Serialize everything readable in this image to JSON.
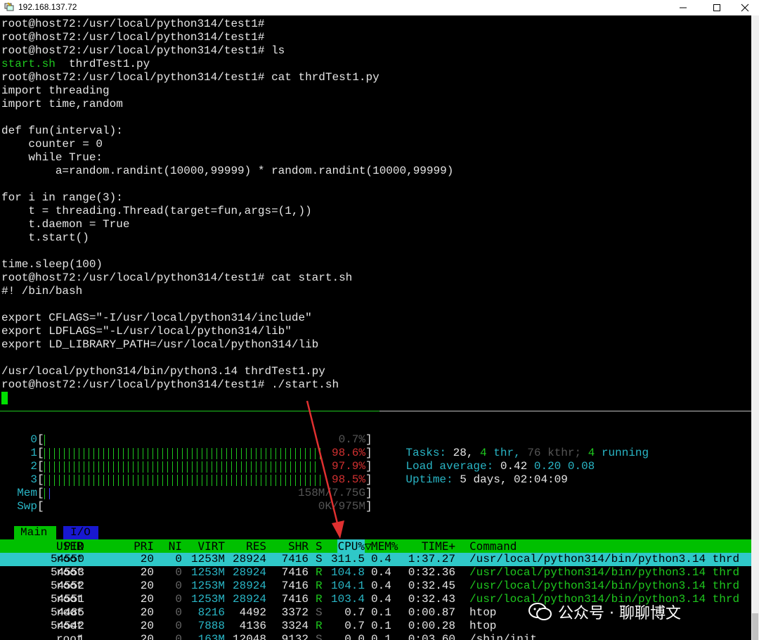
{
  "window": {
    "title": "192.168.137.72"
  },
  "terminal_lines": [
    {
      "segments": [
        {
          "t": "root@host72:/usr/local/python314/test1#",
          "c": "w"
        }
      ]
    },
    {
      "segments": [
        {
          "t": "root@host72:/usr/local/python314/test1#",
          "c": "w"
        }
      ]
    },
    {
      "segments": [
        {
          "t": "root@host72:/usr/local/python314/test1# ls",
          "c": "w"
        }
      ]
    },
    {
      "segments": [
        {
          "t": "start.sh",
          "c": "g"
        },
        {
          "t": "  thrdTest1.py",
          "c": "w"
        }
      ]
    },
    {
      "segments": [
        {
          "t": "root@host72:/usr/local/python314/test1# cat thrdTest1.py",
          "c": "w"
        }
      ]
    },
    {
      "segments": [
        {
          "t": "import threading",
          "c": "w"
        }
      ]
    },
    {
      "segments": [
        {
          "t": "import time,random",
          "c": "w"
        }
      ]
    },
    {
      "segments": [
        {
          "t": "",
          "c": "w"
        }
      ]
    },
    {
      "segments": [
        {
          "t": "def fun(interval):",
          "c": "w"
        }
      ]
    },
    {
      "segments": [
        {
          "t": "    counter = 0",
          "c": "w"
        }
      ]
    },
    {
      "segments": [
        {
          "t": "    while True:",
          "c": "w"
        }
      ]
    },
    {
      "segments": [
        {
          "t": "        a=random.randint(10000,99999) * random.randint(10000,99999)",
          "c": "w"
        }
      ]
    },
    {
      "segments": [
        {
          "t": "",
          "c": "w"
        }
      ]
    },
    {
      "segments": [
        {
          "t": "for i in range(3):",
          "c": "w"
        }
      ]
    },
    {
      "segments": [
        {
          "t": "    t = threading.Thread(target=fun,args=(1,))",
          "c": "w"
        }
      ]
    },
    {
      "segments": [
        {
          "t": "    t.daemon = True",
          "c": "w"
        }
      ]
    },
    {
      "segments": [
        {
          "t": "    t.start()",
          "c": "w"
        }
      ]
    },
    {
      "segments": [
        {
          "t": "",
          "c": "w"
        }
      ]
    },
    {
      "segments": [
        {
          "t": "time.sleep(100)",
          "c": "w"
        }
      ]
    },
    {
      "segments": [
        {
          "t": "root@host72:/usr/local/python314/test1# cat start.sh",
          "c": "w"
        }
      ]
    },
    {
      "segments": [
        {
          "t": "#! /bin/bash",
          "c": "w"
        }
      ]
    },
    {
      "segments": [
        {
          "t": "",
          "c": "w"
        }
      ]
    },
    {
      "segments": [
        {
          "t": "export CFLAGS=\"-I/usr/local/python314/include\"",
          "c": "w"
        }
      ]
    },
    {
      "segments": [
        {
          "t": "export LDFLAGS=\"-L/usr/local/python314/lib\"",
          "c": "w"
        }
      ]
    },
    {
      "segments": [
        {
          "t": "export LD_LIBRARY_PATH=/usr/local/python314/lib",
          "c": "w"
        }
      ]
    },
    {
      "segments": [
        {
          "t": "",
          "c": "w"
        }
      ]
    },
    {
      "segments": [
        {
          "t": "/usr/local/python314/bin/python3.14 thrdTest1.py",
          "c": "w"
        }
      ]
    },
    {
      "segments": [
        {
          "t": "root@host72:/usr/local/python314/test1# ./start.sh",
          "c": "w"
        }
      ]
    }
  ],
  "htop": {
    "cpus": [
      {
        "label": "0",
        "value": "0.7%",
        "level": 0.007
      },
      {
        "label": "1",
        "value": "98.6%",
        "level": 0.986
      },
      {
        "label": "2",
        "value": "97.9%",
        "level": 0.979
      },
      {
        "label": "3",
        "value": "98.5%",
        "level": 0.985
      }
    ],
    "mem": {
      "label": "Mem",
      "value": "158M/7.75G",
      "level": 0.02
    },
    "swp": {
      "label": "Swp",
      "value": "0K/975M",
      "level": 0.0
    },
    "tasks": {
      "label": "Tasks:",
      "count": "28,",
      "thr": "4",
      "thr_label": "thr,",
      "kthr": "76 kthr;",
      "running": "4",
      "running_label": "running"
    },
    "load": {
      "label": "Load average:",
      "v1": "0.42",
      "v5": "0.20",
      "v15": "0.08"
    },
    "uptime": {
      "label": "Uptime:",
      "value": "5 days, 02:04:09"
    },
    "tabs": [
      "Main",
      "I/O"
    ],
    "columns": [
      "PID",
      "USER",
      "PRI",
      "NI",
      "VIRT",
      "RES",
      "SHR",
      "S",
      "CPU%",
      "MEM%",
      "TIME+",
      "Command"
    ],
    "sort_marker": "▽",
    "processes": [
      {
        "pid": "54550",
        "user": "root",
        "pri": "20",
        "ni": "0",
        "virt": "1253M",
        "res": "28924",
        "shr": "7416",
        "s": "S",
        "cpu": "311.5",
        "mem": "0.4",
        "time": "1:37.27",
        "cmd": "/usr/local/python314/bin/python3.14 thrd"
      },
      {
        "pid": "54553",
        "user": "root",
        "pri": "20",
        "ni": "0",
        "virt": "1253M",
        "res": "28924",
        "shr": "7416",
        "s": "R",
        "cpu": "104.8",
        "mem": "0.4",
        "time": "0:32.36",
        "cmd": "/usr/local/python314/bin/python3.14 thrd"
      },
      {
        "pid": "54552",
        "user": "root",
        "pri": "20",
        "ni": "0",
        "virt": "1253M",
        "res": "28924",
        "shr": "7416",
        "s": "R",
        "cpu": "104.1",
        "mem": "0.4",
        "time": "0:32.45",
        "cmd": "/usr/local/python314/bin/python3.14 thrd"
      },
      {
        "pid": "54551",
        "user": "root",
        "pri": "20",
        "ni": "0",
        "virt": "1253M",
        "res": "28924",
        "shr": "7416",
        "s": "R",
        "cpu": "103.4",
        "mem": "0.4",
        "time": "0:32.43",
        "cmd": "/usr/local/python314/bin/python3.14 thrd"
      },
      {
        "pid": "54485",
        "user": "root",
        "pri": "20",
        "ni": "0",
        "virt": "8216",
        "res": "4492",
        "shr": "3372",
        "s": "S",
        "cpu": "0.7",
        "mem": "0.1",
        "time": "0:00.87",
        "cmd": "htop"
      },
      {
        "pid": "54542",
        "user": "root",
        "pri": "20",
        "ni": "0",
        "virt": "7888",
        "res": "4136",
        "shr": "3324",
        "s": "R",
        "cpu": "0.7",
        "mem": "0.1",
        "time": "0:00.28",
        "cmd": "htop"
      },
      {
        "pid": "1",
        "user": "root",
        "pri": "20",
        "ni": "0",
        "virt": "163M",
        "res": "12048",
        "shr": "9132",
        "s": "S",
        "cpu": "0.0",
        "mem": "0.1",
        "time": "0:03.60",
        "cmd": "/sbin/init"
      }
    ]
  },
  "watermark": {
    "text": "公众号 · 聊聊博文"
  },
  "colors": {
    "prompt": "#e6e6e6",
    "green": "#1ec81e",
    "cyan": "#29b6c6",
    "red": "#d03030",
    "header_bg": "#00c000",
    "selected_bg": "#2fc8c8",
    "arrow": "#e03030"
  }
}
